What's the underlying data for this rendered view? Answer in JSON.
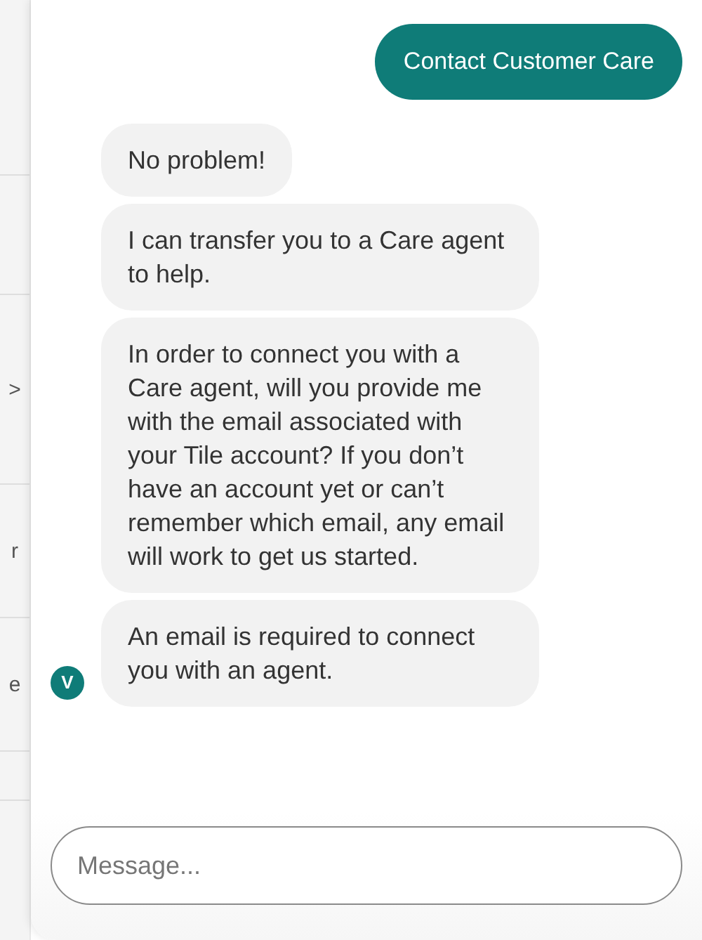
{
  "background_page": {
    "fragments": [
      ">",
      "r",
      "e"
    ]
  },
  "messages": [
    {
      "kind": "outgoing",
      "text": "Contact Customer Care"
    },
    {
      "kind": "incoming",
      "text": "No problem!"
    },
    {
      "kind": "incoming",
      "text": "I can transfer you to a Care agent to help."
    },
    {
      "kind": "incoming",
      "text": "In order to connect you with a Care agent, will you provide me with the email associated with your Tile account? If you don’t have an account yet or can’t remember which email, any email will work to get us started."
    },
    {
      "kind": "incoming",
      "text": "An email is required to connect you with an agent.",
      "avatar": "V"
    }
  ],
  "composer": {
    "placeholder": "Message..."
  }
}
